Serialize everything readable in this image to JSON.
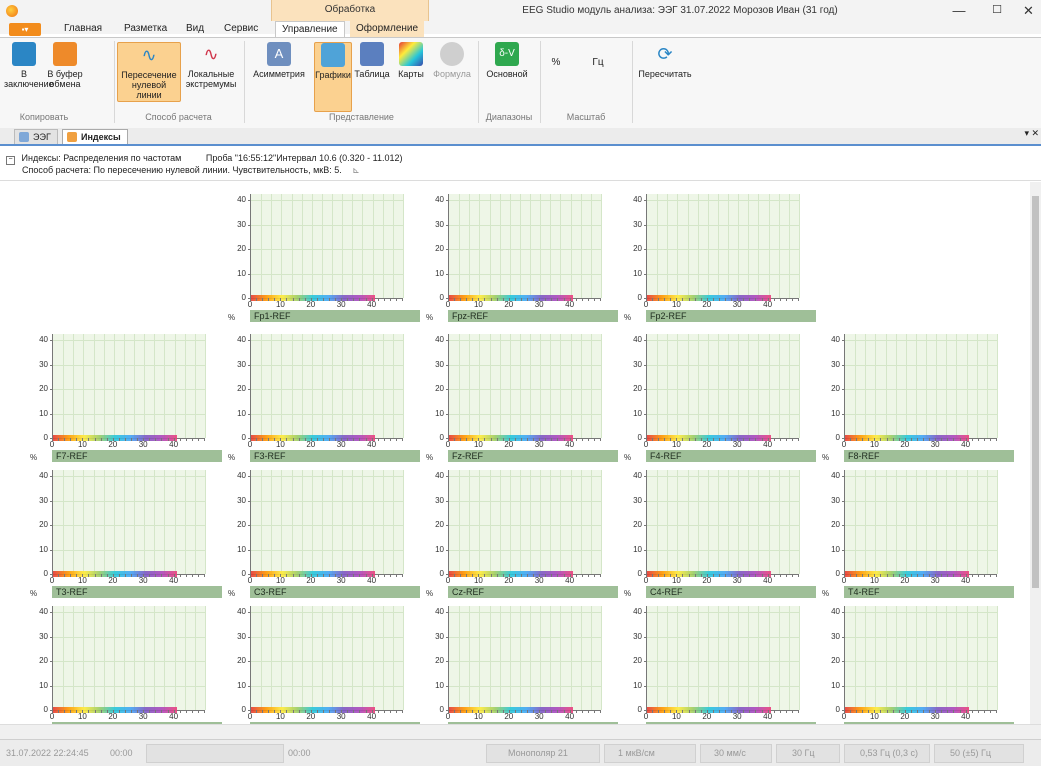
{
  "window": {
    "title": "EEG Studio модуль анализа: ЭЭГ 31.07.2022 Морозов Иван (31 год)",
    "context_group": "Обработка",
    "minimize": "—",
    "maximize": "☐",
    "close": "✕"
  },
  "app_menu": "▪▾",
  "tabs": [
    "Главная",
    "Разметка",
    "Вид",
    "Сервис",
    "Управление",
    "Оформление"
  ],
  "active_tab": "Управление",
  "ribbon": {
    "copy": {
      "to_conclusion": "В заключение",
      "to_clipboard": "В буфер обмена",
      "group": "Копировать"
    },
    "method": {
      "zero_cross": "Пересечение нулевой линии",
      "local_extrema": "Локальные экстремумы",
      "group": "Способ расчета"
    },
    "view": {
      "asymmetry": "Асимметрия",
      "charts": "Графики",
      "table": "Таблица",
      "maps": "Карты",
      "formula": "Формула",
      "group": "Представление"
    },
    "ranges": {
      "main": "Основной",
      "group": "Диапазоны"
    },
    "scale": {
      "percent": "%",
      "hz": "Гц",
      "group": "Масштаб"
    },
    "recalc": "Пересчитать"
  },
  "doc_tabs": {
    "eeg": "ЭЭГ",
    "indexes": "Индексы",
    "pane_menu": "▾ ✕"
  },
  "info": {
    "line1": "Индексы: Распределения по частотам",
    "probe": "Проба \"16:55:12\"Интервал 10.6 (0.320 - 11.012)",
    "line2": "Способ расчета: По пересечению нулевой линии. Чувствительность, мкВ: 5.",
    "collapse": "−",
    "expand": "⊾"
  },
  "axis": {
    "y_ticks": [
      "0",
      "10",
      "20",
      "30",
      "40"
    ],
    "x_ticks": [
      "0",
      "10",
      "20",
      "30",
      "40"
    ],
    "y_unit": "%"
  },
  "chart_data": {
    "type": "bar",
    "ylim": [
      0,
      40
    ],
    "xlim": [
      0,
      50
    ],
    "grid": true,
    "ylabel": "%",
    "channels": [
      "Fp1-REF",
      "Fpz-REF",
      "Fp2-REF",
      "F7-REF",
      "F3-REF",
      "Fz-REF",
      "F4-REF",
      "F8-REF",
      "T3-REF",
      "C3-REF",
      "Cz-REF",
      "C4-REF",
      "T4-REF"
    ],
    "values": []
  },
  "rows": [
    {
      "panels": [
        null,
        "Fp1-REF",
        "Fpz-REF",
        "Fp2-REF",
        null
      ]
    },
    {
      "panels": [
        "F7-REF",
        "F3-REF",
        "Fz-REF",
        "F4-REF",
        "F8-REF"
      ]
    },
    {
      "panels": [
        "T3-REF",
        "C3-REF",
        "Cz-REF",
        "C4-REF",
        "T4-REF"
      ]
    },
    {
      "panels": [
        "",
        "",
        "",
        "",
        ""
      ]
    }
  ],
  "status": {
    "datetime": "31.07.2022 22:24:45",
    "time1": "00:00",
    "time2": "00:00",
    "montage": "Монополяр 21",
    "sensitivity": "1 мкВ/см",
    "speed": "30 мм/с",
    "hf": "30 Гц",
    "lf": "0,53 Гц (0,3 с)",
    "notch": "50 (±5) Гц"
  },
  "colors": {
    "accent": "#f28c1c",
    "context_tab": "#fbe2bd",
    "plot_bg": "#eef6e7",
    "channel_label": "#9fbf98"
  }
}
